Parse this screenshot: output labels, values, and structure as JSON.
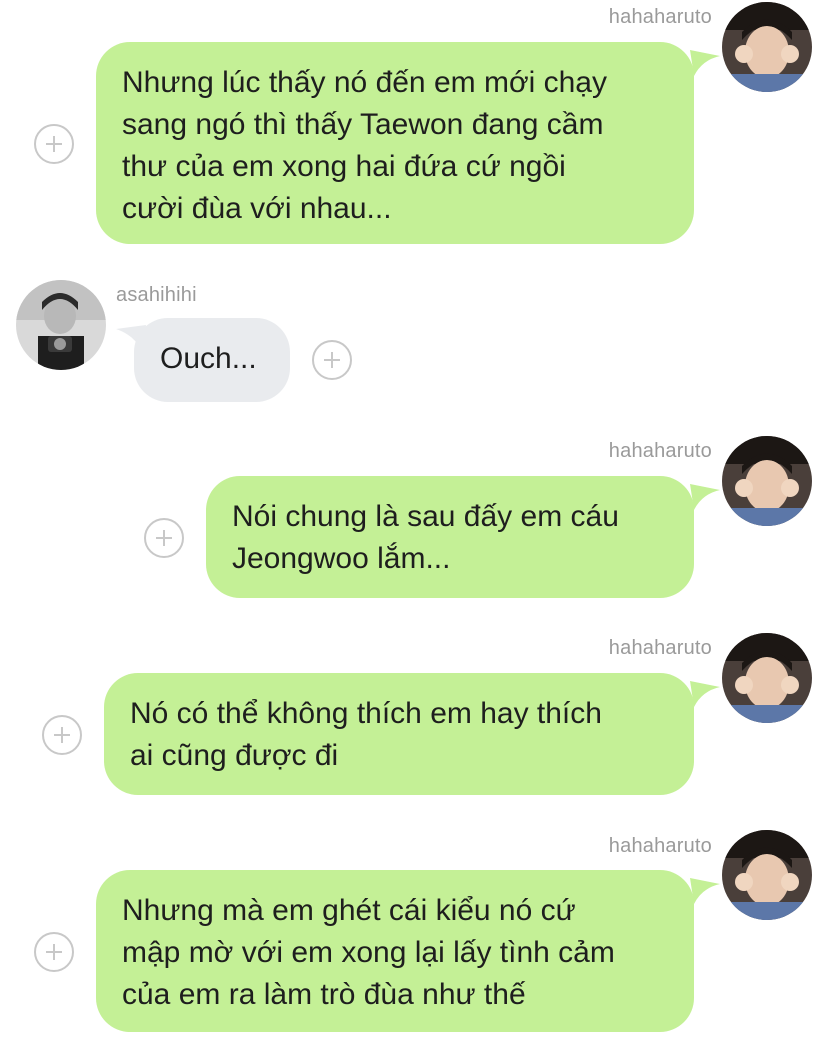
{
  "messages": [
    {
      "sender": "hahaharuto",
      "side": "right",
      "text": "Nhưng lúc thấy nó đến em mới chạy\nsang ngó thì thấy Taewon đang cầm\nthư của em xong hai đứa cứ ngồi\ncười đùa với nhau..."
    },
    {
      "sender": "asahihihi",
      "side": "left",
      "text": "Ouch..."
    },
    {
      "sender": "hahaharuto",
      "side": "right",
      "text": "Nói chung là sau đấy em cáu\nJeongwoo lắm..."
    },
    {
      "sender": "hahaharuto",
      "side": "right",
      "text": "Nó có thể không thích em hay thích\nai cũng được đi"
    },
    {
      "sender": "hahaharuto",
      "side": "right",
      "text": "Nhưng mà em ghét cái kiểu nó cứ\nmập mờ với em xong lại lấy tình cảm\ncủa em ra làm trò đùa như thế"
    }
  ],
  "colors": {
    "sent_bubble": "#c4f096",
    "received_bubble": "#e9ebee",
    "username": "#9a9a9a",
    "plus_button": "#c8c8c8"
  },
  "icons": {
    "add_reaction": "plus-circle-icon"
  }
}
